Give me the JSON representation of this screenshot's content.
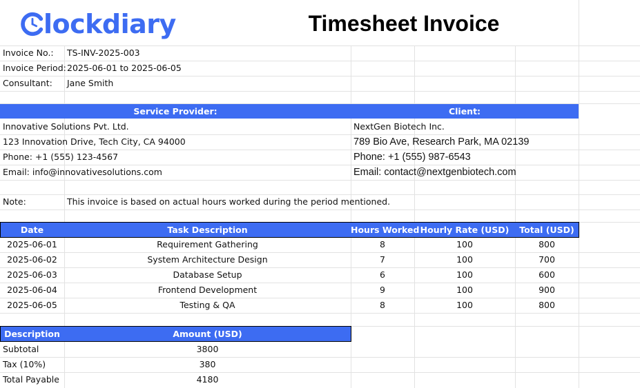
{
  "logo": {
    "text": "lockdiary",
    "icon": "clock-c-icon",
    "color": "#3d6cf2"
  },
  "title": "Timesheet Invoice",
  "colors": {
    "accent": "#3d6cf2",
    "gridline": "#e2e2e2",
    "header_text": "#ffffff"
  },
  "meta": {
    "invoice_no_label": "Invoice No.:",
    "invoice_no_value": "TS-INV-2025-003",
    "period_label": "Invoice Period:",
    "period_value": "2025-06-01 to 2025-06-05",
    "consultant_label": "Consultant:",
    "consultant_value": "Jane Smith"
  },
  "parties": {
    "provider_header": "Service Provider:",
    "client_header": "Client:",
    "provider": {
      "name": "Innovative Solutions Pvt. Ltd.",
      "address": "123 Innovation Drive, Tech City, CA 94000",
      "phone": "Phone: +1 (555) 123-4567",
      "email": "Email: info@innovativesolutions.com"
    },
    "client": {
      "name": "NextGen Biotech Inc.",
      "address": "789 Bio Ave, Research Park, MA 02139",
      "phone": "Phone: +1 (555) 987-6543",
      "email": "Email: contact@nextgenbiotech.com"
    }
  },
  "note": {
    "label": "Note:",
    "text": "This invoice is based on actual hours worked during the period mentioned."
  },
  "timesheet": {
    "headers": [
      "Date",
      "Task Description",
      "Hours Worked",
      "Hourly Rate (USD)",
      "Total (USD)"
    ],
    "rows": [
      {
        "date": "2025-06-01",
        "task": "Requirement Gathering",
        "hours": "8",
        "rate": "100",
        "total": "800"
      },
      {
        "date": "2025-06-02",
        "task": "System Architecture Design",
        "hours": "7",
        "rate": "100",
        "total": "700"
      },
      {
        "date": "2025-06-03",
        "task": "Database Setup",
        "hours": "6",
        "rate": "100",
        "total": "600"
      },
      {
        "date": "2025-06-04",
        "task": "Frontend Development",
        "hours": "9",
        "rate": "100",
        "total": "900"
      },
      {
        "date": "2025-06-05",
        "task": "Testing & QA",
        "hours": "8",
        "rate": "100",
        "total": "800"
      }
    ]
  },
  "summary": {
    "headers": [
      "Description",
      "Amount (USD)"
    ],
    "rows": [
      {
        "label": "Subtotal",
        "amount": "3800"
      },
      {
        "label": "Tax (10%)",
        "amount": "380"
      },
      {
        "label": "Total Payable",
        "amount": "4180"
      }
    ]
  }
}
